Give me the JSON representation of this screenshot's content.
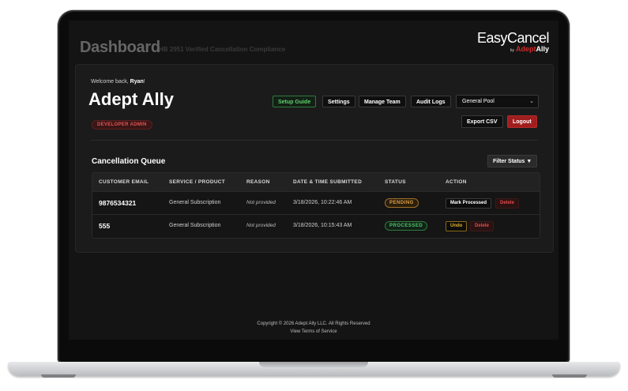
{
  "header": {
    "title": "Dashboard",
    "subtitle": "HB 2951 Verified Cancellation Compliance",
    "logo_main": "EasyCancel",
    "logo_by": "by",
    "logo_adept": "Adept",
    "logo_ally": "Ally"
  },
  "account": {
    "welcome_prefix": "Welcome back, ",
    "user_name": "Ryan",
    "welcome_suffix": "!",
    "org_name": "Adept Ally",
    "role_badge": "DEVELOPER ADMIN"
  },
  "toolbar": {
    "setup_guide": "Setup Guide",
    "settings": "Settings",
    "manage_team": "Manage Team",
    "audit_logs": "Audit Logs",
    "pool_selected": "General Pool",
    "export_csv": "Export CSV",
    "logout": "Logout"
  },
  "queue": {
    "title": "Cancellation Queue",
    "filter_label": "Filter Status ▼",
    "columns": [
      "CUSTOMER EMAIL",
      "SERVICE / PRODUCT",
      "REASON",
      "DATE & TIME SUBMITTED",
      "STATUS",
      "ACTION"
    ],
    "rows": [
      {
        "email": "9876534321",
        "service": "General Subscription",
        "reason": "Not provided",
        "submitted": "3/18/2026, 10:22:46 AM",
        "status": "PENDING",
        "primary_action": "Mark Processed",
        "delete_action": "Delete"
      },
      {
        "email": "555",
        "service": "General Subscription",
        "reason": "Not provided",
        "submitted": "3/18/2026, 10:15:43 AM",
        "status": "PROCESSED",
        "primary_action": "Undo",
        "delete_action": "Delete"
      }
    ]
  },
  "footer": {
    "copyright": "Copyright © 2026 Adept Ally LLC. All Rights Reserved",
    "terms_link": "View Terms of Service"
  },
  "colors": {
    "accent_red": "#a01e1e",
    "setup_green": "#5fd16b",
    "pending_amber": "#e0a24b",
    "processed_green": "#4fc46a"
  }
}
